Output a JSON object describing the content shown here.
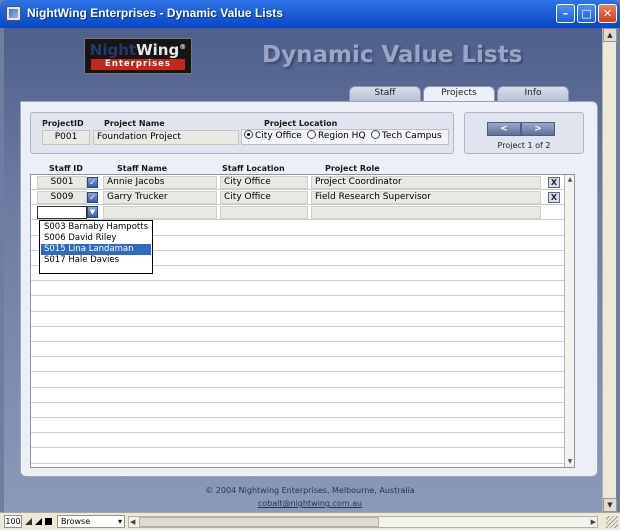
{
  "window": {
    "title": "NightWing Enterprises - Dynamic Value Lists"
  },
  "logo": {
    "line1_a": "Night",
    "line1_b": "Wing",
    "mark": "®",
    "line2": "Enterprises"
  },
  "heading": "Dynamic Value Lists",
  "tabs": [
    {
      "label": "Staff",
      "active": false
    },
    {
      "label": "Projects",
      "active": true
    },
    {
      "label": "Info",
      "active": false
    }
  ],
  "project": {
    "id_label": "ProjectID",
    "id_value": "P001",
    "name_label": "Project Name",
    "name_value": "Foundation Project",
    "location_label": "Project Location",
    "locations": [
      {
        "label": "City Office",
        "selected": true
      },
      {
        "label": "Region HQ",
        "selected": false
      },
      {
        "label": "Tech Campus",
        "selected": false
      }
    ]
  },
  "nav": {
    "prev": "<",
    "next": ">",
    "record_count": "Project 1 of 2"
  },
  "portal": {
    "headers": {
      "staff_id": "Staff ID",
      "staff_name": "Staff Name",
      "staff_location": "Staff Location",
      "project_role": "Project Role"
    },
    "rows": [
      {
        "staff_id": "S001",
        "staff_name": "Annie Jacobs",
        "staff_location": "City Office",
        "project_role": "Project Coordinator"
      },
      {
        "staff_id": "S009",
        "staff_name": "Garry Trucker",
        "staff_location": "City Office",
        "project_role": "Field Research Supervisor"
      }
    ],
    "delete_label": "X",
    "check_label": "✓"
  },
  "dropdown": {
    "options": [
      {
        "label": "S003 Barnaby Hampotts",
        "selected": false
      },
      {
        "label": "S006 David Riley",
        "selected": false
      },
      {
        "label": "S015 Lina Landaman",
        "selected": true
      },
      {
        "label": "S017 Hale Davies",
        "selected": false
      }
    ]
  },
  "footer": {
    "copyright": "© 2004 Nightwing Enterprises, Melbourne, Australia",
    "email": "cobalt@nightwing.com.au"
  },
  "statusbar": {
    "zoom": "100",
    "mode": "Browse"
  },
  "colors": {
    "titlebar": "#0a46c4",
    "selection": "#316ac5",
    "background": "#6f7da0"
  }
}
